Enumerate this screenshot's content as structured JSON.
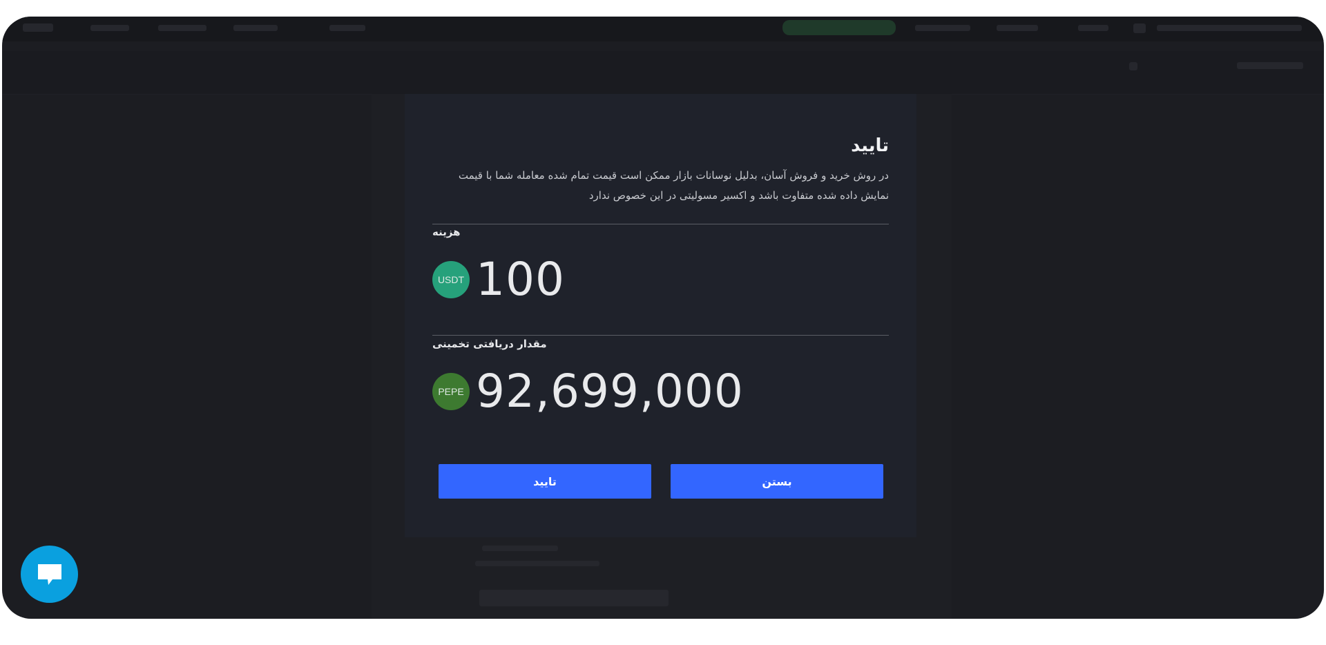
{
  "modal": {
    "title": "تایید",
    "description": "در روش خرید و فروش آسان، بدلیل نوسانات بازار ممکن است قیمت تمام شده معامله شما با قیمت نمایش داده شده متفاوت باشد و اکسیر مسولیتی در این خصوص ندارد",
    "cost": {
      "label": "هزینه",
      "coin": "USDT",
      "coin_color": "#26a17b",
      "value": "100"
    },
    "estimated": {
      "label": "مقدار دریافتی تخمینی",
      "coin": "PEPE",
      "coin_color": "#3d7a30",
      "value": "92,699,000"
    },
    "buttons": {
      "close_label": "بستن",
      "confirm_label": "تایید",
      "color": "#3366ff"
    }
  },
  "chat": {
    "icon": "chat-bubble-icon",
    "color": "#0aa0df"
  }
}
